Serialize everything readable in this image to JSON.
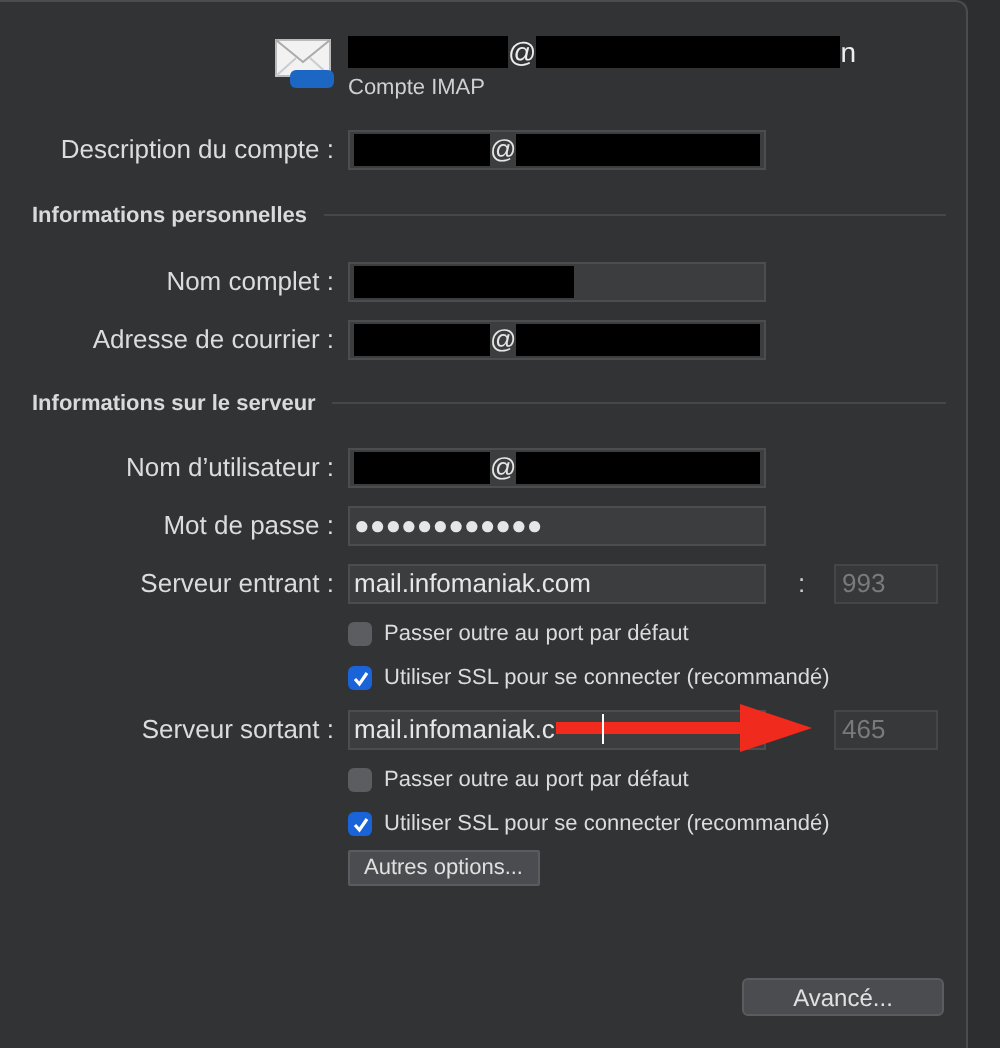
{
  "header": {
    "title": [
      {
        "kind": "redacted"
      },
      {
        "kind": "text",
        "text": "@"
      },
      {
        "kind": "redacted"
      },
      {
        "kind": "text",
        "text": "n"
      }
    ],
    "subtitle": "Compte IMAP"
  },
  "rows": [
    {
      "kind": "field",
      "label": "Description du compte :",
      "value": [
        {
          "kind": "redacted"
        },
        {
          "kind": "text",
          "text": "@"
        },
        {
          "kind": "redacted"
        }
      ]
    },
    {
      "kind": "section",
      "label": "Informations personnelles"
    },
    {
      "kind": "field",
      "label": "Nom complet :",
      "value": [
        {
          "kind": "redacted"
        }
      ]
    },
    {
      "kind": "field",
      "label": "Adresse de courrier :",
      "value": [
        {
          "kind": "redacted"
        },
        {
          "kind": "text",
          "text": "@"
        },
        {
          "kind": "redacted"
        }
      ]
    },
    {
      "kind": "section",
      "label": "Informations sur le serveur"
    },
    {
      "kind": "field",
      "label": "Nom d’utilisateur :",
      "value": [
        {
          "kind": "redacted"
        },
        {
          "kind": "text",
          "text": "@"
        },
        {
          "kind": "redacted"
        }
      ]
    },
    {
      "kind": "field",
      "label": "Mot de passe :",
      "value": [
        {
          "kind": "text",
          "text": "●●●●●●●●●●●●"
        }
      ]
    },
    {
      "kind": "field",
      "label": "Serveur entrant :",
      "value": [
        {
          "kind": "text",
          "text": "mail.infomaniak.com"
        }
      ],
      "separator": ":",
      "port": {
        "text": "993",
        "disabled": true
      }
    },
    {
      "kind": "checkbox",
      "label": "Passer outre au port par défaut",
      "checked": false
    },
    {
      "kind": "checkbox",
      "label": "Utiliser SSL pour se connecter (recommandé)",
      "checked": true
    },
    {
      "kind": "field",
      "label": "Serveur sortant :",
      "value": [
        {
          "kind": "text",
          "text": "mail.infomaniak.c"
        }
      ],
      "caret": true,
      "port": {
        "text": "465",
        "disabled": true
      },
      "annotation": {
        "kind": "arrow"
      }
    },
    {
      "kind": "checkbox",
      "label": "Passer outre au port par défaut",
      "checked": false
    },
    {
      "kind": "checkbox",
      "label": "Utiliser SSL pour se connecter (recommandé)",
      "checked": true
    },
    {
      "kind": "button",
      "label": "Autres options..."
    }
  ],
  "footer": {
    "button": "Avancé..."
  }
}
